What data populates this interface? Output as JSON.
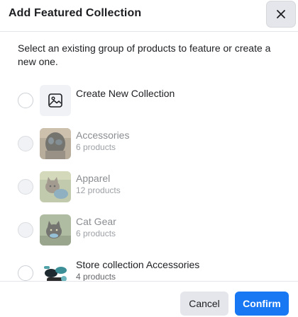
{
  "dialog": {
    "title": "Add Featured Collection",
    "close_icon": "close-icon",
    "description": "Select an existing group of products to feature or create a new one."
  },
  "collections": [
    {
      "title": "Create New Collection",
      "subtitle": "",
      "thumb": "image-placeholder-icon",
      "state": "enabled"
    },
    {
      "title": "Accessories",
      "subtitle": "6 products",
      "thumb": "dog-photo",
      "state": "disabled"
    },
    {
      "title": "Apparel",
      "subtitle": "12 products",
      "thumb": "cat-photo",
      "state": "disabled"
    },
    {
      "title": "Cat Gear",
      "subtitle": "6 products",
      "thumb": "cat-photo",
      "state": "disabled"
    },
    {
      "title": "Store collection Accessories",
      "subtitle": "4 products",
      "thumb": "accessories-photo",
      "state": "enabled"
    }
  ],
  "footer": {
    "cancel_label": "Cancel",
    "confirm_label": "Confirm"
  },
  "colors": {
    "primary": "#1877f2",
    "secondary_button": "#e4e6eb",
    "text": "#1c1e21",
    "muted_text": "#65676b"
  }
}
